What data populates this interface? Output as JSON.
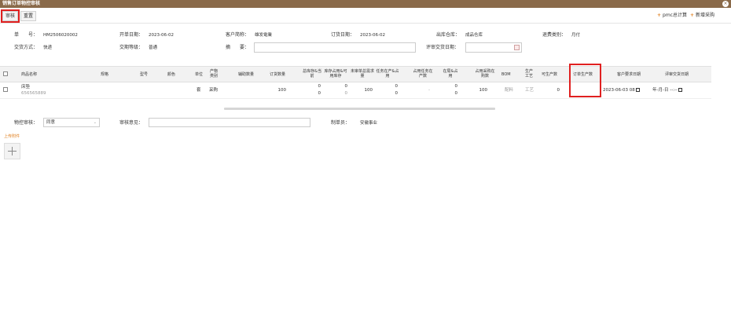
{
  "window": {
    "title": "销售订单物控审核",
    "close_icon": "close-icon"
  },
  "toolbar": {
    "audit_label": "审核",
    "reset_label": "重置",
    "pmc_label": "pmc总计算",
    "new_purchase_label": "新增采购"
  },
  "header": {
    "order_no_label": "单　　号：",
    "order_no": "HM2506020002",
    "open_date_label": "开单日期：",
    "open_date": "2023-06-02",
    "customer_label": "客户简称：",
    "customer": "雄发電業",
    "order_date_label": "订货日期：",
    "order_date": "2023-06-02",
    "warehouse_label": "出库仓库：",
    "warehouse": "成品仓库",
    "return_type_label": "退费类别：",
    "return_type": "月付",
    "trade_method_label": "交货方式：",
    "trade_method": "快递",
    "level_label": "交期等级：",
    "level": "普通",
    "summary_label": "摘　　要：",
    "summary_value": "",
    "review_date_label": "评审交货日期：",
    "review_date_value": ""
  },
  "table": {
    "headers": [
      "商品名称",
      "规格",
      "型号",
      "颜色",
      "单位",
      "产物类别",
      "辅助数量",
      "订货数量",
      "总库存&当前",
      "库存占用&可用库存",
      "未审单总需求量",
      "任务在产&占用",
      "占用任务在产数",
      "在局&占用",
      "占用采购在购数",
      "BOM",
      "生产工艺",
      "可生产数",
      "订单生产数",
      "客户要求日期",
      "评审交货日期"
    ],
    "rows": [
      {
        "name": "床垫",
        "code": "656565889",
        "spec": "",
        "model": "",
        "color": "",
        "unit": "套",
        "category": "采购",
        "aux_qty": "",
        "order_qty": "100",
        "total_stock": "0",
        "current": "0",
        "stock_occupied": "0",
        "available_stock": "0",
        "unreviewed_demand": "100",
        "task_in_production": "0",
        "task_occupied": "0",
        "occupied_task": "-",
        "in_bureau": "0",
        "bureau_occupied": "0",
        "occupied_purchase": "100",
        "bom": "配料",
        "process": "工艺",
        "producible": "0",
        "order_production": "",
        "customer_date": "2023-06-03 08",
        "review_date": "年-月-日 --:--"
      }
    ]
  },
  "footer": {
    "material_review_label": "物控审核：",
    "material_review_value": "同意",
    "opinion_label": "审核意见：",
    "opinion_value": "",
    "creator_label": "制单员：",
    "creator": "安徽事业",
    "upload_label": "上传附件"
  }
}
